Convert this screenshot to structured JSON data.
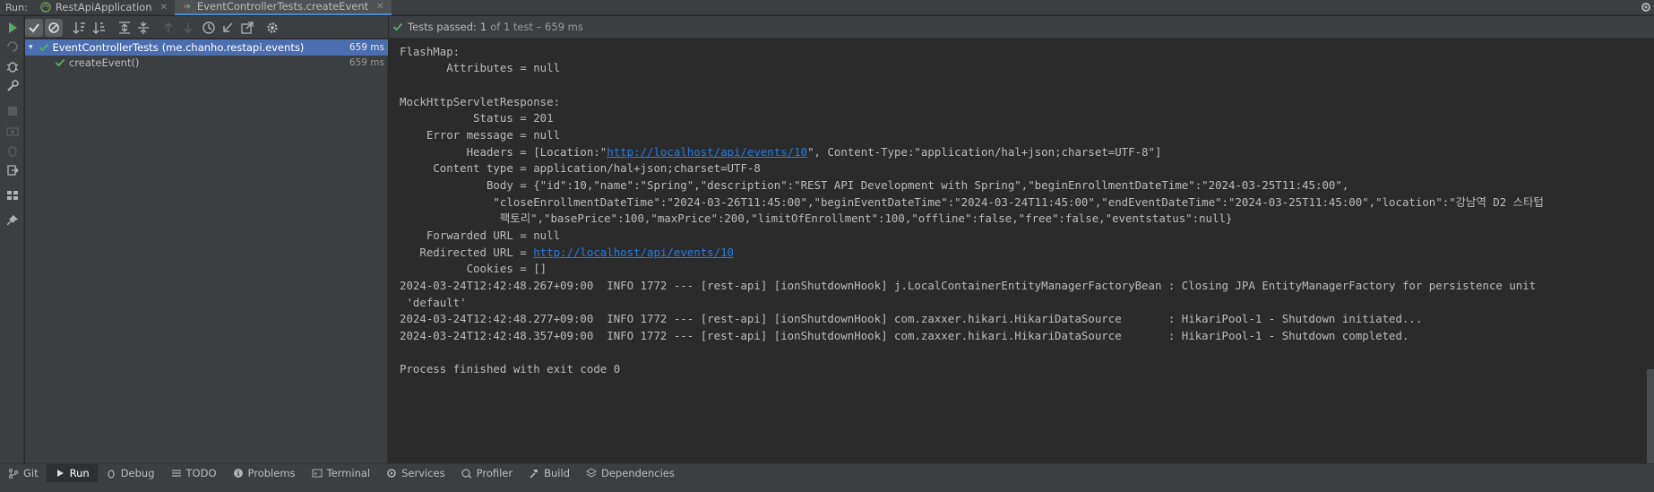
{
  "top_tabs": {
    "run_label": "Run:",
    "tabs": [
      {
        "label": "RestApiApplication"
      },
      {
        "label": "EventControllerTests.createEvent"
      }
    ]
  },
  "status": {
    "prefix": "Tests passed:",
    "count": "1",
    "suffix": "of 1 test – 659 ms"
  },
  "tree": {
    "root": {
      "label": "EventControllerTests",
      "package": "(me.chanho.restapi.events)",
      "duration": "659 ms"
    },
    "child": {
      "label": "createEvent()",
      "duration": "659 ms"
    }
  },
  "console": {
    "l1": "FlashMap:",
    "l2": "       Attributes = null",
    "l3": "",
    "l4": "MockHttpServletResponse:",
    "l5": "           Status = 201",
    "l6": "    Error message = null",
    "l7a": "          Headers = [Location:\"",
    "l7link": "http://localhost/api/events/10",
    "l7b": "\", Content-Type:\"application/hal+json;charset=UTF-8\"]",
    "l8": "     Content type = application/hal+json;charset=UTF-8",
    "l9": "             Body = {\"id\":10,\"name\":\"Spring\",\"description\":\"REST API Development with Spring\",\"beginEnrollmentDateTime\":\"2024-03-25T11:45:00\",",
    "l10": "              \"closeEnrollmentDateTime\":\"2024-03-26T11:45:00\",\"beginEventDateTime\":\"2024-03-24T11:45:00\",\"endEventDateTime\":\"2024-03-25T11:45:00\",\"location\":\"강남역 D2 스타텁",
    "l11": "               팩토리\",\"basePrice\":100,\"maxPrice\":200,\"limitOfEnrollment\":100,\"offline\":false,\"free\":false,\"eventstatus\":null}",
    "l12": "    Forwarded URL = null",
    "l13a": "   Redirected URL = ",
    "l13link": "http://localhost/api/events/10",
    "l14": "          Cookies = []",
    "l15": "2024-03-24T12:42:48.267+09:00  INFO 1772 --- [rest-api] [ionShutdownHook] j.LocalContainerEntityManagerFactoryBean : Closing JPA EntityManagerFactory for persistence unit",
    "l16": " 'default'",
    "l17": "2024-03-24T12:42:48.277+09:00  INFO 1772 --- [rest-api] [ionShutdownHook] com.zaxxer.hikari.HikariDataSource       : HikariPool-1 - Shutdown initiated...",
    "l18": "2024-03-24T12:42:48.357+09:00  INFO 1772 --- [rest-api] [ionShutdownHook] com.zaxxer.hikari.HikariDataSource       : HikariPool-1 - Shutdown completed.",
    "l19": "",
    "l20": "Process finished with exit code 0"
  },
  "bottom_tools": {
    "git": "Git",
    "run": "Run",
    "debug": "Debug",
    "todo": "TODO",
    "problems": "Problems",
    "terminal": "Terminal",
    "services": "Services",
    "profiler": "Profiler",
    "build": "Build",
    "dependencies": "Dependencies"
  },
  "colors": {
    "accent": "#4a88c7",
    "selection": "#4b6eaf",
    "pass_green": "#59a869",
    "link": "#287bde"
  }
}
